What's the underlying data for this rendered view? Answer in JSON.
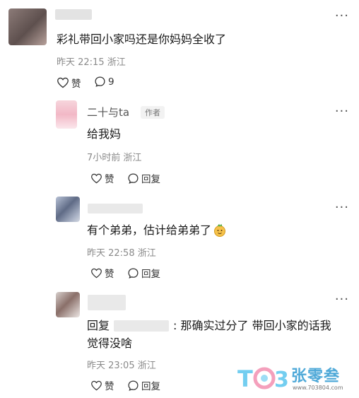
{
  "comment": {
    "text": "彩礼带回小家吗还是你妈妈全收了",
    "meta": "昨天 22:15 浙江",
    "like_label": "赞",
    "reply_count": "9"
  },
  "replies": [
    {
      "name": "二十与ta",
      "tag": "作者",
      "text": "给我妈",
      "meta": "7小时前 浙江",
      "like_label": "赞",
      "reply_label": "回复"
    },
    {
      "text": "有个弟弟，估计给弟弟了",
      "meta": "昨天 22:58 浙江",
      "like_label": "赞",
      "reply_label": "回复"
    },
    {
      "reply_prefix": "回复",
      "text_line1": ": 那确实过分了 带回小家的话我",
      "text_line2": "觉得没啥",
      "meta": "昨天 23:05 浙江",
      "like_label": "赞",
      "reply_label": "回复"
    }
  ],
  "watermark": {
    "brand": "张零叁",
    "url": "www.703804.com"
  },
  "colors": {
    "accent_blue": "#5bc6ee",
    "accent_pink": "#f28fb0"
  }
}
